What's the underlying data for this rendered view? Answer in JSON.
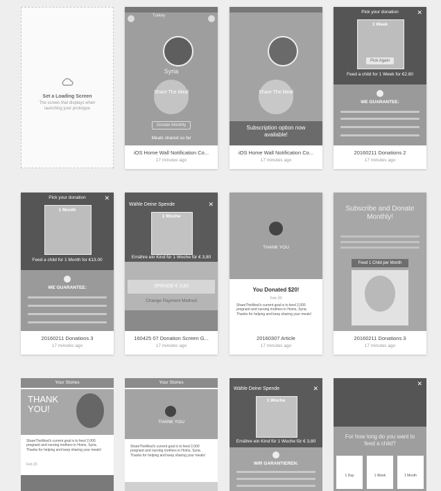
{
  "empty_slot": {
    "title": "Set a Loading Screen",
    "desc": "The screen that displays when launching your prototype"
  },
  "cards": [
    {
      "title": "iOS Home Wall Notification Co...",
      "time": "17 minutes ago",
      "country": "Turkey",
      "city": "Syria",
      "share": "Share The Meal",
      "cta": "Donate Monthly",
      "foot": "Meals shared so far"
    },
    {
      "title": "iOS Home Wall Notification Co...",
      "time": "17 minutes ago",
      "share": "Share The Meal",
      "banner": "Subscription option now available!"
    },
    {
      "title": "20160211 Donations 2",
      "time": "17 minutes ago",
      "pick": "Pick your donation",
      "period": "1 Week",
      "btn": "Pick Again",
      "feed": "Feed a child for 1 Week for €2.80",
      "guar": "WE GUARANTEE:"
    },
    {
      "title": "20160211 Donations 3",
      "time": "17 minutes ago",
      "pick": "Pick your donation",
      "period": "1 Month",
      "feed": "Feed a child for 1 Month for €13.00",
      "guar": "WE GUARANTEE:"
    },
    {
      "title": "160425 07 Donation Screen G...",
      "time": "17 minutes ago",
      "head": "Wähle Deine Spende",
      "period": "1 Woche",
      "line": "Ernähre ein Kind für 1 Woche für € 3,80",
      "spend": "SPENDE € 3,80",
      "change": "Change Payment Method"
    },
    {
      "title": "20160307 Article",
      "time": "17 minutes ago",
      "thanks": "THANK YOU",
      "donated": "You Donated $20!",
      "date": "Feb 20",
      "body": "ShareTheMeal's current goal is to feed 2,000 pregnant and nursing mothers in Homs, Syria. Thanks for helping and keep sharing your meals!"
    },
    {
      "title": "20160211 Donations 3",
      "time": "17 minutes ago",
      "sub": "Subscribe and Donate Monthly!",
      "feed": "Feed 1 Child per Month"
    },
    {
      "head": "Your Stories",
      "thanks": "THANK YOU!",
      "body": "ShareTheMeal's current goal is to feed 2,000 pregnant and nursing mothers in Homs, Syria. Thanks for helping and keep sharing your meals!",
      "date": "Feb 20"
    },
    {
      "head": "Your Stories",
      "thanks": "THANK YOU",
      "body": "ShareTheMeal's current goal is to feed 2,000 pregnant and nursing mothers in Homs, Syria. Thanks for helping and keep sharing your meals!"
    },
    {
      "head": "Wähle Deine Spende",
      "period": "1 Woche",
      "line": "Ernähre ein Kind für 1 Woche für € 3,80",
      "guar": "WIR GARANTIEREN:"
    },
    {
      "question": "For how long do you want to feed a child?",
      "o1": "1 Day",
      "o2": "1 Week",
      "o3": "1 Month"
    }
  ],
  "colors": {
    "bg": "#eeeeee",
    "screen": "#a6a6a6",
    "dark": "#555555"
  }
}
